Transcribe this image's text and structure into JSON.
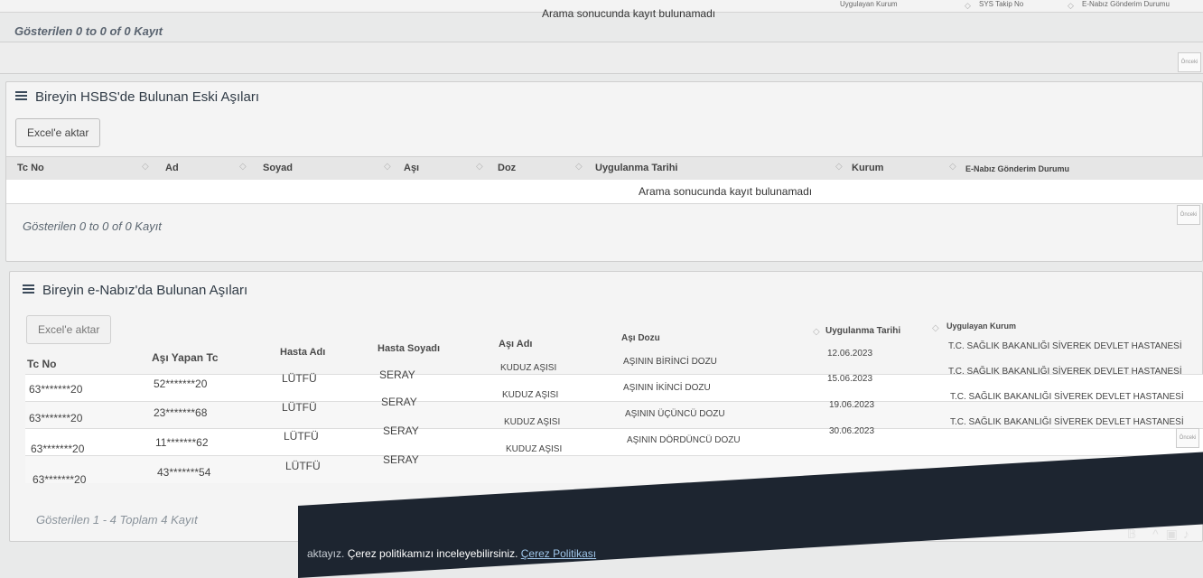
{
  "top_section": {
    "headers": [
      "Uygulayan Kurum",
      "SYS Takip No",
      "E-Nabız Gönderim Durumu"
    ],
    "empty_message": "Arama sonucunda kayıt bulunamadı",
    "shown_text": "Gösterilen 0 to 0 of 0 Kayıt",
    "side_button": "Önceki"
  },
  "hsbs_panel": {
    "title": "Bireyin HSBS'de Bulunan Eski Aşıları",
    "excel_label": "Excel'e aktar",
    "columns": [
      "Tc No",
      "Ad",
      "Soyad",
      "Aşı",
      "Doz",
      "Uygulanma Tarihi",
      "Kurum",
      "E-Nabız Gönderim Durumu"
    ],
    "empty_message": "Arama sonucunda kayıt bulunamadı",
    "shown_text": "Gösterilen 0 to 0 of 0 Kayıt",
    "side_button": "Önceki"
  },
  "enabiz_panel": {
    "title": "Bireyin e-Nabız'da Bulunan Aşıları",
    "excel_label": "Excel'e aktar",
    "columns": [
      "Tc No",
      "Aşı Yapan Tc",
      "Hasta Adı",
      "Hasta Soyadı",
      "Aşı Adı",
      "Aşı Dozu",
      "Uygulanma Tarihi",
      "Uygulayan Kurum"
    ],
    "rows": [
      {
        "tc": "63*******20",
        "yapan": "52*******20",
        "ad": "LÜTFÜ",
        "soyad": "SERAY",
        "asi": "KUDUZ AŞISI",
        "doz": "AŞININ BİRİNCİ DOZU",
        "tarih": "12.06.2023",
        "kurum": "T.C. SAĞLIK BAKANLIĞI SİVEREK DEVLET HASTANESİ"
      },
      {
        "tc": "63*******20",
        "yapan": "23*******68",
        "ad": "LÜTFÜ",
        "soyad": "SERAY",
        "asi": "KUDUZ AŞISI",
        "doz": "AŞININ İKİNCİ DOZU",
        "tarih": "15.06.2023",
        "kurum": "T.C. SAĞLIK BAKANLIĞI SİVEREK DEVLET HASTANESİ"
      },
      {
        "tc": "63*******20",
        "yapan": "11*******62",
        "ad": "LÜTFÜ",
        "soyad": "SERAY",
        "asi": "KUDUZ AŞISI",
        "doz": "AŞININ ÜÇÜNCÜ DOZU",
        "tarih": "19.06.2023",
        "kurum": "T.C. SAĞLIK BAKANLIĞI SİVEREK DEVLET HASTANESİ"
      },
      {
        "tc": "63*******20",
        "yapan": "43*******54",
        "ad": "LÜTFÜ",
        "soyad": "SERAY",
        "asi": "KUDUZ AŞISI",
        "doz": "AŞININ DÖRDÜNCÜ DOZU",
        "tarih": "30.06.2023",
        "kurum": "T.C. SAĞLIK BAKANLIĞI SİVEREK DEVLET HASTANESİ"
      }
    ],
    "shown_text": "Gösterilen 1 - 4 Toplam 4 Kayıt",
    "side_button": "Önceki"
  },
  "cookie": {
    "prefix": "aktayız. ",
    "text": "Çerez politikamızı inceleyebilirsiniz. ",
    "link": "Çerez Politikası"
  },
  "tray": {
    "icons": [
      "person-icon",
      "chevron-up-icon",
      "monitor-icon",
      "speaker-icon"
    ]
  },
  "colors": {
    "page_bg": "#e9eaea",
    "panel_bg": "#f4f4f4",
    "header_bg": "#e6e6e6",
    "title_color": "#2f3a45",
    "cookie_bar": "#1d2530"
  }
}
